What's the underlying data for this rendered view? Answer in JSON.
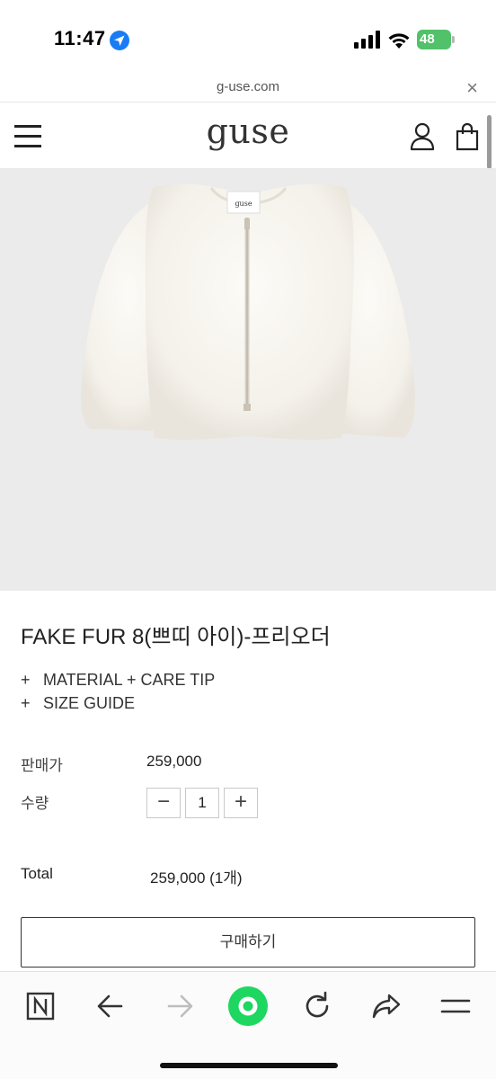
{
  "status_bar": {
    "time": "11:47",
    "battery": "48"
  },
  "url_bar": {
    "url": "g-use.com",
    "close_glyph": "×"
  },
  "header": {
    "logo": "guse"
  },
  "product": {
    "title": "FAKE FUR 8(쁘띠 아이)-프리오더",
    "accordion": [
      {
        "plus": "+",
        "label": "MATERIAL + CARE TIP"
      },
      {
        "plus": "+",
        "label": "SIZE GUIDE"
      }
    ],
    "price_label": "판매가",
    "price": "259,000",
    "qty_label": "수량",
    "qty_minus": "−",
    "qty_value": "1",
    "qty_plus": "+",
    "total_label": "Total",
    "total_value": "259,000 (1개)",
    "buy_label": "구매하기"
  },
  "toolbar": {
    "icons": [
      "naver-n-icon",
      "back-arrow-icon",
      "forward-arrow-icon",
      "green-circle-icon",
      "reload-icon",
      "share-icon",
      "menu-icon"
    ]
  },
  "colors": {
    "battery": "#52c26a",
    "green_button": "#1ed760",
    "image_bg": "#ebebeb"
  }
}
